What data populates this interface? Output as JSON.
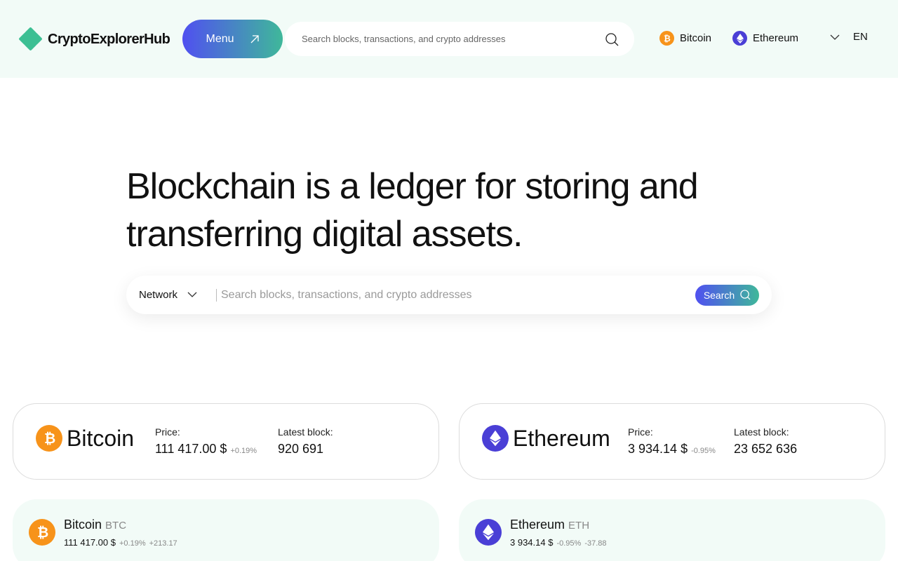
{
  "header": {
    "logo_text": "CryptoExplorerHub",
    "menu_label": "Menu",
    "search_placeholder": "Search blocks, transactions, and crypto addresses",
    "networks": [
      "Bitcoin",
      "Ethereum"
    ],
    "language": "EN"
  },
  "hero": {
    "title": "Blockchain is a ledger for storing and transferring digital assets.",
    "network_label": "Network",
    "search_placeholder": "Search blocks, transactions, and crypto addresses",
    "search_button": "Search"
  },
  "cards": [
    {
      "name": "Bitcoin",
      "price_label": "Price:",
      "price": "111 417.00 $",
      "change": "+0.19%",
      "block_label": "Latest block:",
      "block": "920 691"
    },
    {
      "name": "Ethereum",
      "price_label": "Price:",
      "price": "3 934.14 $",
      "change": "-0.95%",
      "block_label": "Latest block:",
      "block": "23 652 636"
    }
  ],
  "panels": [
    {
      "name": "Bitcoin",
      "ticker": "BTC",
      "price": "111 417.00 $",
      "change_pct": "+0.19%",
      "change_abs": "+213.17"
    },
    {
      "name": "Ethereum",
      "ticker": "ETH",
      "price": "3 934.14 $",
      "change_pct": "-0.95%",
      "change_abs": "-37.88"
    }
  ],
  "colors": {
    "brand_green": "#3cbf93",
    "gradient_start": "#5050f0",
    "gradient_end": "#3fb89a",
    "bitcoin": "#f7931a",
    "ethereum": "#4a3fd6",
    "header_bg": "#f2fbf7"
  },
  "icons": [
    "logo-icon",
    "arrow-up-right-icon",
    "search-icon",
    "bitcoin-icon",
    "ethereum-icon",
    "chevron-down-icon"
  ]
}
